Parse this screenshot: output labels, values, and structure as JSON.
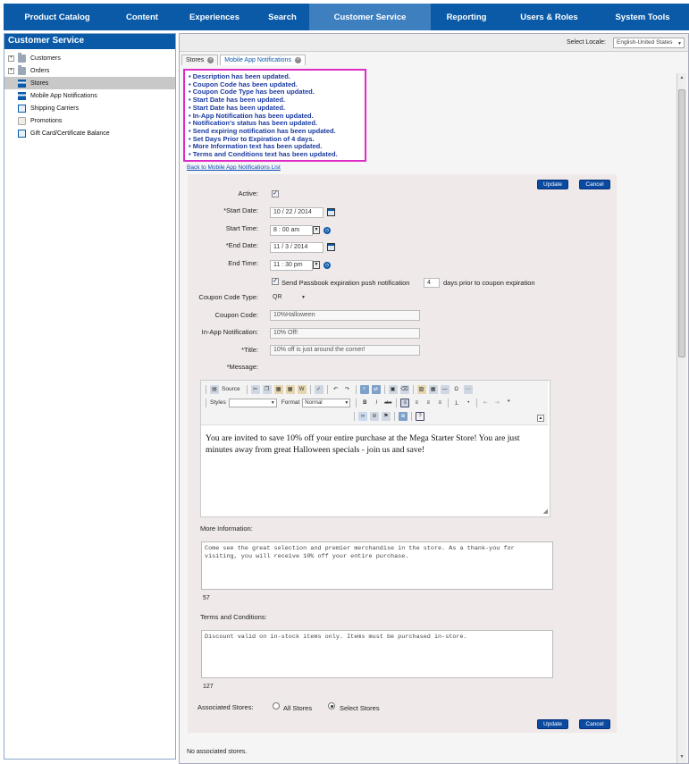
{
  "nav": {
    "items": [
      {
        "label": "Product Catalog"
      },
      {
        "label": "Content"
      },
      {
        "label": "Experiences"
      },
      {
        "label": "Search"
      },
      {
        "label": "Customer Service",
        "active": true
      },
      {
        "label": "Reporting"
      },
      {
        "label": "Users & Roles"
      },
      {
        "label": "System Tools"
      }
    ]
  },
  "sidebar": {
    "title": "Customer Service",
    "items": [
      {
        "label": "Customers",
        "icon": "folder-icon",
        "expandable": true
      },
      {
        "label": "Orders",
        "icon": "folder-icon",
        "expandable": true
      },
      {
        "label": "Stores",
        "icon": "store-icon",
        "selected": true
      },
      {
        "label": "Mobile App Notifications",
        "icon": "store-icon"
      },
      {
        "label": "Shipping Carriers",
        "icon": "document-icon"
      },
      {
        "label": "Promotions",
        "icon": "promotion-icon"
      },
      {
        "label": "Gift Card/Certificate Balance",
        "icon": "document-icon"
      }
    ]
  },
  "locale": {
    "label": "Select Locale:",
    "value": "English-United States"
  },
  "tabs": [
    {
      "label": "Stores"
    },
    {
      "label": "Mobile App Notifications",
      "active": true
    }
  ],
  "messages": [
    "• Description has been updated.",
    "• Coupon Code has been updated.",
    "• Coupon Code Type has been updated.",
    "• Start Date has been updated.",
    "• Start Date has been updated.",
    "• In-App Notification has been updated.",
    "• Notification's status has been updated.",
    "• Send expiring notification has been updated.",
    "• Set Days Prior to Expiration of 4 days.",
    "• More Information text has been updated.",
    "• Terms and Conditions text has been updated."
  ],
  "back_link": "Back to Mobile App Notifications List",
  "buttons": {
    "update": "Update",
    "cancel": "Cancel"
  },
  "form": {
    "active_label": "Active:",
    "active_checked": "✓",
    "start_date_label": "*Start Date:",
    "start_date": "10 / 22 /  2014",
    "start_time_label": "Start Time:",
    "start_time": "8 : 00    am",
    "end_date_label": "*End Date:",
    "end_date": "11 / 3 /  2014",
    "end_time_label": "End Time:",
    "end_time": "11 : 30    pm",
    "passbook_checked": "✓",
    "passbook_label": "Send Passbook expiration push notification",
    "passbook_days": "4",
    "passbook_suffix": "days prior to coupon expiration",
    "coupon_type_label": "Coupon Code Type:",
    "coupon_type": "QR",
    "coupon_code_label": "Coupon Code:",
    "coupon_code": "10%Halloween",
    "inapp_label": "In-App Notification:",
    "inapp": "10% Off!",
    "title_label": "*Title:",
    "title": "10% off is just around the corner!",
    "message_label": "*Message:",
    "more_info_label": "More Information:",
    "more_info": "Come see the great selection and premier merchandise in the store.  As a thank-you for visiting, you will receive 10% off your entire purchase.",
    "more_info_count": "57",
    "terms_label": "Terms and Conditions:",
    "terms": "Discount valid on in-stock items only.  Items must be purchased in-store.",
    "terms_count": "127",
    "assoc_label": "Associated Stores:",
    "all_stores": "All Stores",
    "select_stores": "Select Stores"
  },
  "editor": {
    "source_label": "Source",
    "styles_label": "Styles",
    "format_label": "Format",
    "format_value": "Normal",
    "body": "You are invited to save 10% off your entire purchase at the Mega Starter Store!  You are just minutes away from great Halloween specials - join us and save!"
  },
  "footer_note": "No associated stores."
}
